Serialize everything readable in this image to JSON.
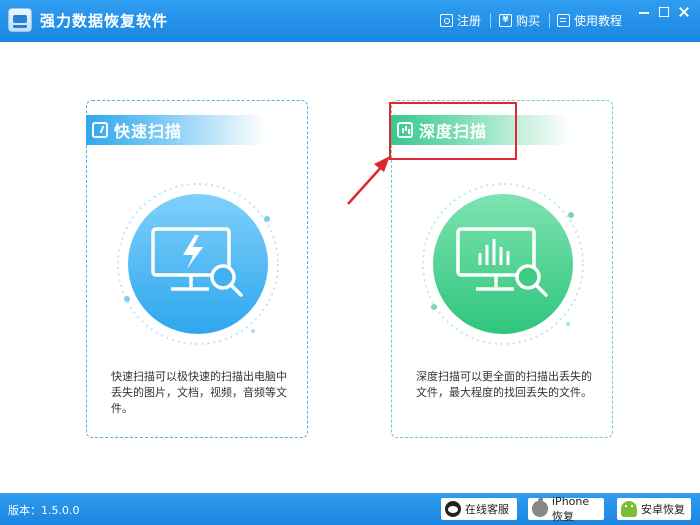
{
  "app": {
    "title": "强力数据恢复软件"
  },
  "toolbar": {
    "register_label": "注册",
    "buy_label": "购买",
    "buy_icon_glyph": "¥",
    "help_label": "使用教程"
  },
  "modes": {
    "quick": {
      "title": "快速扫描",
      "description": "快速扫描可以极快速的扫描出电脑中丢失的图片，文档，视频，音频等文件。",
      "accent": "#2fa7ee"
    },
    "deep": {
      "title": "深度扫描",
      "description": "深度扫描可以更全面的扫描出丢失的文件，最大程度的找回丢失的文件。",
      "accent": "#34c98e"
    }
  },
  "status": {
    "version": "版本：1.5.0.0",
    "service_label": "在线客服",
    "iphone_label": "iPhone恢复",
    "android_label": "安卓恢复"
  },
  "colors": {
    "titlebar": "#1b86e2",
    "highlight": "#e0262e"
  }
}
